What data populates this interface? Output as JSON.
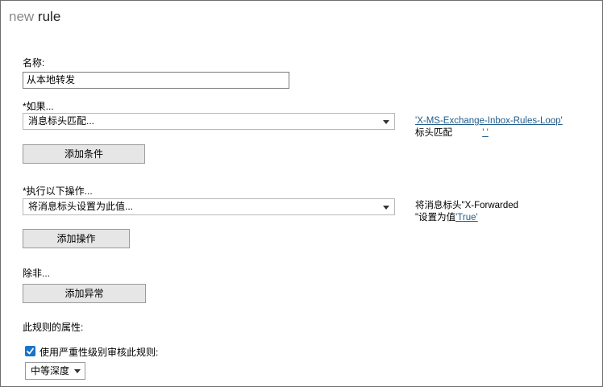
{
  "header": {
    "title_prefix": "new",
    "title_main": "rule"
  },
  "form": {
    "name_label": "名称:",
    "name_value": "从本地转发",
    "condition_label": "*如果...",
    "condition_select": "消息标头匹配...",
    "add_condition_button": "添加条件",
    "condition_summary": {
      "header_link": "'X-MS-Exchange-Inbox-Rules-Loop'",
      "match_text": "标头匹配",
      "value_link": "' '"
    },
    "action_label": "*执行以下操作...",
    "action_select": "将消息标头设置为此值...",
    "add_action_button": "添加操作",
    "action_summary": {
      "line1": "将消息标头\"X-Forwarded",
      "line2_prefix": "\"设置为值",
      "value_link": "'True'"
    },
    "exception_label": "除非...",
    "add_exception_button": "添加异常",
    "properties_label": "此规则的属性:",
    "audit_checkbox_label": "使用严重性级别审核此规则:",
    "audit_checked": true,
    "severity_select": "中等深度"
  },
  "colors": {
    "link": "#1f5a8a",
    "checkbox": "#1a73c8",
    "button_bg": "#e6e6e6"
  }
}
